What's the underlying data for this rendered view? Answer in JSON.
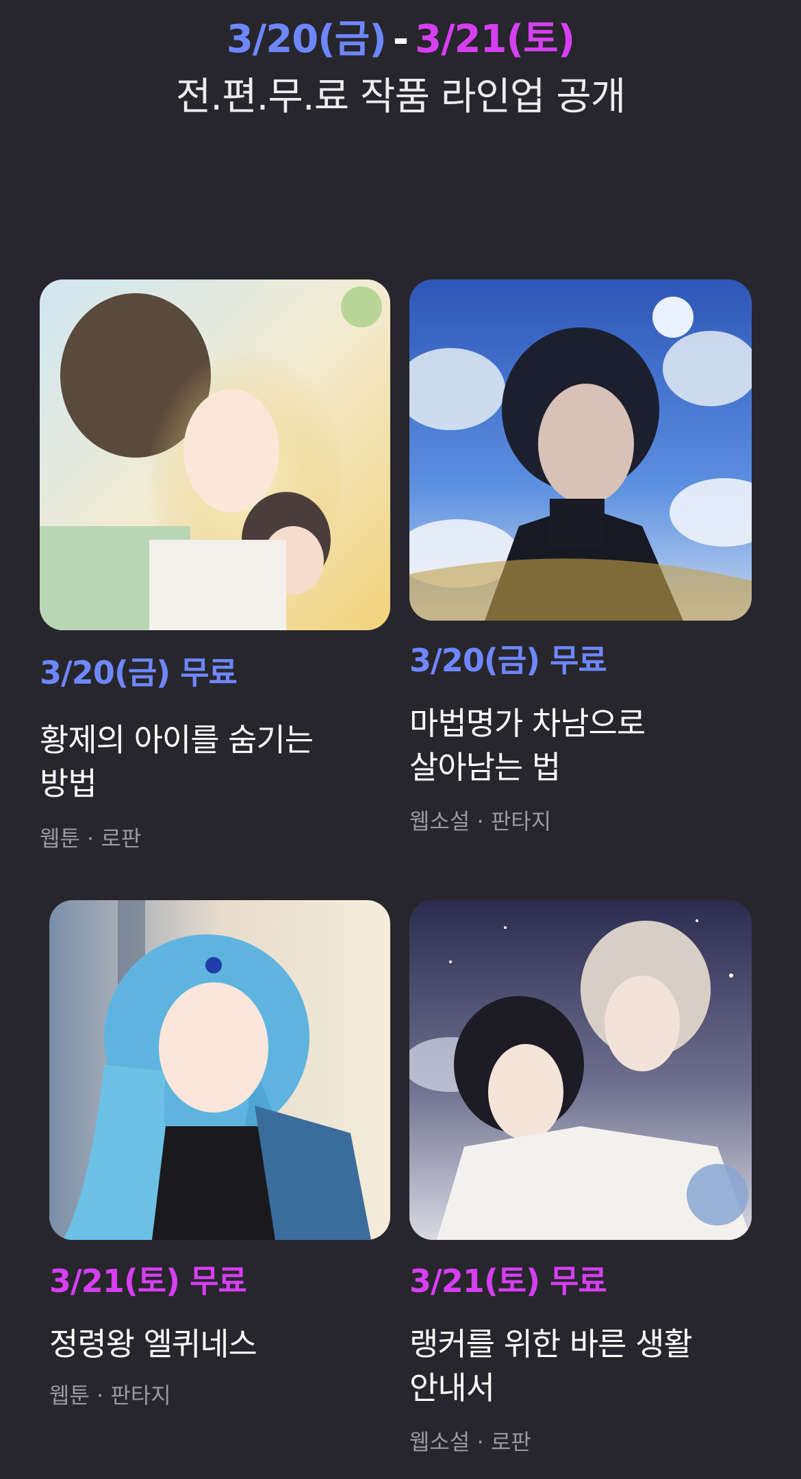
{
  "header": {
    "date_start": "3/20(금)",
    "separator": "-",
    "date_end": "3/21(토)",
    "subtitle": "전.편.무.료 작품 라인업 공개"
  },
  "colors": {
    "background": "#27262c",
    "blue_accent": "#6e87ff",
    "pink_accent": "#d63ff2",
    "genre_text": "#9a99a2"
  },
  "works": [
    {
      "free_label": "3/20(금) 무료",
      "title_line1": "황제의 아이를 숨기는",
      "title_line2": "방법",
      "genre": "웹툰 · 로판",
      "accent": "blue"
    },
    {
      "free_label": "3/20(금) 무료",
      "title_line1": "마법명가 차남으로",
      "title_line2": "살아남는 법",
      "genre": "웹소설 · 판타지",
      "accent": "blue"
    },
    {
      "free_label": "3/21(토) 무료",
      "title_line1": "정령왕 엘퀴네스",
      "title_line2": "",
      "genre": "웹툰 · 판타지",
      "accent": "pink"
    },
    {
      "free_label": "3/21(토) 무료",
      "title_line1": "랭커를 위한 바른 생활",
      "title_line2": "안내서",
      "genre": "웹소설 · 로판",
      "accent": "pink"
    }
  ]
}
